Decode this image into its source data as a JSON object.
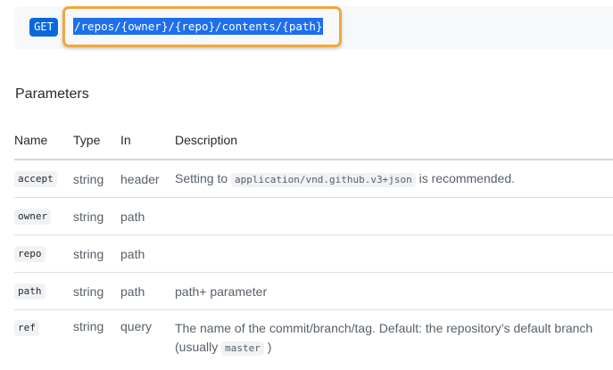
{
  "endpoint": {
    "method": "GET",
    "path": "/repos/{owner}/{repo}/contents/{path}"
  },
  "parameters": {
    "title": "Parameters",
    "columns": [
      "Name",
      "Type",
      "In",
      "Description"
    ],
    "rows": [
      {
        "name": "accept",
        "type": "string",
        "in": "header",
        "desc_pre": "Setting to",
        "desc_code": "application/vnd.github.v3+json",
        "desc_post": "is recommended."
      },
      {
        "name": "owner",
        "type": "string",
        "in": "path"
      },
      {
        "name": "repo",
        "type": "string",
        "in": "path"
      },
      {
        "name": "path",
        "type": "string",
        "in": "path",
        "desc": "path+ parameter"
      },
      {
        "name": "ref",
        "type": "string",
        "in": "query",
        "desc_line1": "The name of the commit/branch/tag. Default: the repository’s default branch",
        "desc_line2_pre": "(usually",
        "desc_code": "master",
        "desc_line2_post": ")"
      }
    ]
  },
  "colors": {
    "method_badge": "#0969da",
    "highlight_border": "#f0a73a",
    "selection": "#1f6feb"
  }
}
